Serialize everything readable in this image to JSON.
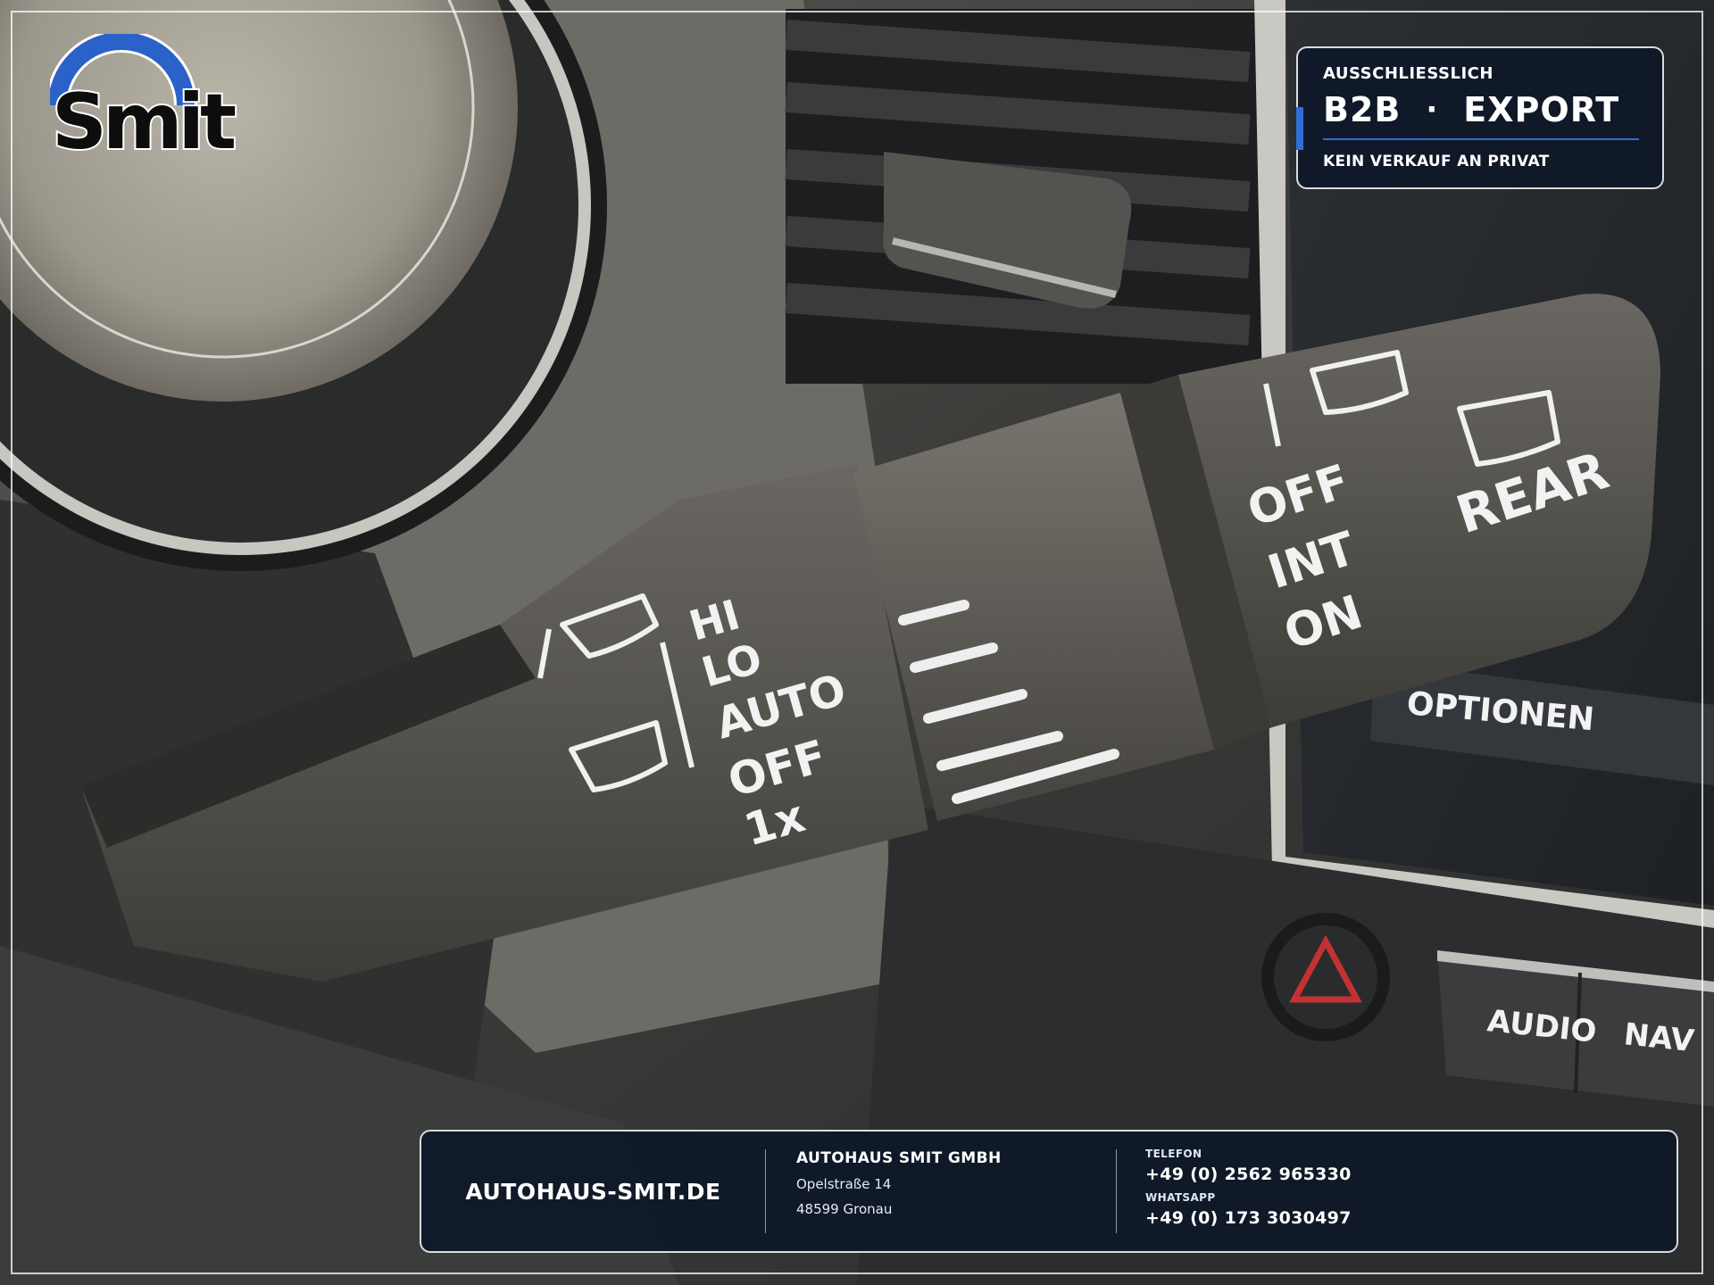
{
  "brand": {
    "logo_text": "Smit"
  },
  "badge": {
    "top_line": "AUSSCHLIESSLICH",
    "left_word": "B2B",
    "separator": "·",
    "right_word": "EXPORT",
    "sub_line": "KEIN VERKAUF AN PRIVAT"
  },
  "footer": {
    "website": "AUTOHAUS-SMIT.DE",
    "company": "AUTOHAUS SMIT GMBH",
    "street": "Opelstraße 14",
    "city": "48599 Gronau",
    "phone_label": "TELEFON",
    "phone": "+49 (0) 2562 965330",
    "whatsapp_label": "WHATSAPP",
    "whatsapp": "+49 (0) 173 3030497"
  },
  "photo": {
    "stalk_labels": {
      "hi": "HI",
      "lo": "LO",
      "auto": "AUTO",
      "off": "OFF",
      "once": "1x",
      "rear_off": "OFF",
      "rear_int": "INT",
      "rear_on": "ON",
      "rear": "REAR"
    },
    "dash_labels": {
      "optionen": "OPTIONEN",
      "audio": "AUDIO",
      "nav": "NAV"
    }
  },
  "colors": {
    "frame_bg": "#0b1626",
    "accent": "#2e6fd6",
    "logo_arc": "#2a62c9"
  }
}
